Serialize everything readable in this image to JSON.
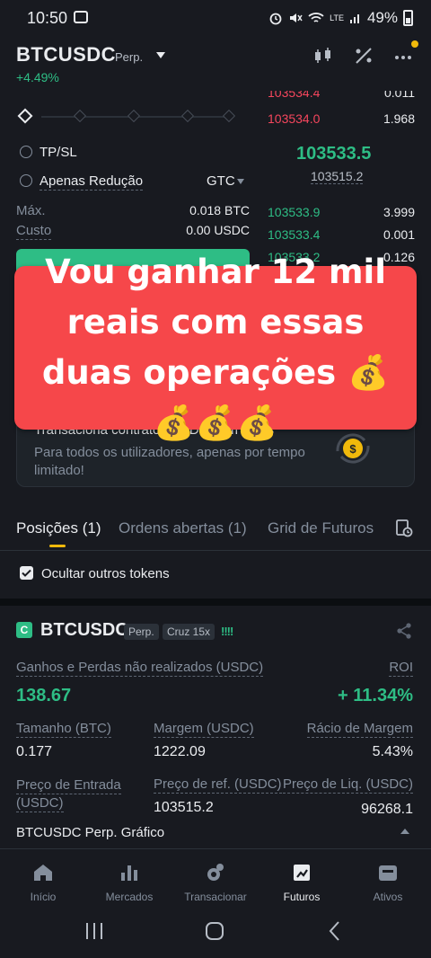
{
  "status": {
    "time": "10:50",
    "battery": "49%",
    "lte": "LTE"
  },
  "header": {
    "pair": "BTCUSDC",
    "perp": "Perp.",
    "change": "+4.49%"
  },
  "order_form": {
    "tpsl": "TP/SL",
    "reduce_only": "Apenas Redução",
    "tif": "GTC",
    "max_label": "Máx.",
    "max_value": "0.018 BTC",
    "cost_label": "Custo",
    "cost_value": "0.00 USDC"
  },
  "order_book": {
    "asks": [
      {
        "price": "103534.4",
        "qty": "0.011"
      },
      {
        "price": "103534.0",
        "qty": "1.968"
      }
    ],
    "mid": "103533.5",
    "mark": "103515.2",
    "bids": [
      {
        "price": "103533.9",
        "qty": "3.999"
      },
      {
        "price": "103533.4",
        "qty": "0.001"
      },
      {
        "price": "103533.2",
        "qty": "0.126"
      }
    ]
  },
  "overlay": {
    "text": "Vou ganhar 12 mil reais com essas duas operações 💰💰💰💰"
  },
  "promo": {
    "title": "Transaciona contratos USDC sem taxas",
    "subtitle": "Para todos os utilizadores, apenas por tempo limitado!"
  },
  "tabs": [
    {
      "label": "Posições (1)"
    },
    {
      "label": "Ordens abertas (1)"
    },
    {
      "label": "Grid de Futuros"
    }
  ],
  "hide_tokens": "Ocultar outros tokens",
  "position": {
    "badge": "C",
    "symbol": "BTCUSDC",
    "type": "Perp.",
    "margin_mode": "Cruz 15x",
    "leverage_bars": "!!!!",
    "pnl_label": "Ganhos e Perdas não realizados (USDC)",
    "pnl_value": "138.67",
    "roi_label": "ROI",
    "roi_value": "+ 11.34%",
    "size_label": "Tamanho (BTC)",
    "size_value": "0.177",
    "margin_label": "Margem (USDC)",
    "margin_value": "1222.09",
    "ratio_label": "Rácio de Margem",
    "ratio_value": "5.43%",
    "entry_label_1": "Preço de Entrada",
    "entry_label_2": "(USDC)",
    "entry_value": "",
    "ref_label": "Preço de ref. (USDC)",
    "ref_value": "103515.2",
    "liq_label": "Preço de Liq. (USDC)",
    "liq_value": "96268.1"
  },
  "chart_row": "BTCUSDC Perp. Gráfico",
  "nav": [
    {
      "label": "Início",
      "icon": "home-icon"
    },
    {
      "label": "Mercados",
      "icon": "markets-icon"
    },
    {
      "label": "Transacionar",
      "icon": "trade-icon"
    },
    {
      "label": "Futuros",
      "icon": "futures-icon",
      "active": true
    },
    {
      "label": "Ativos",
      "icon": "wallet-icon"
    }
  ],
  "colors": {
    "green": "#2ebd85",
    "red": "#f6465d",
    "accent": "#f0b90b",
    "overlay": "#f6474a"
  }
}
